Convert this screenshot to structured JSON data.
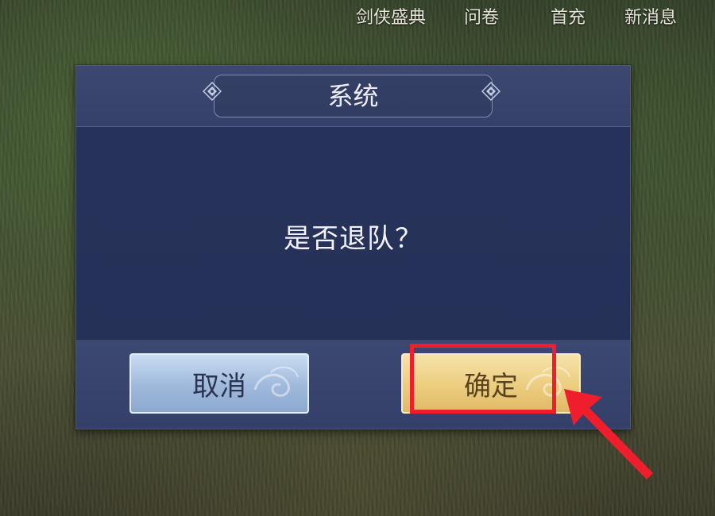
{
  "top_menu": {
    "items": [
      "剑侠盛典",
      "问卷",
      "首充",
      "新消息"
    ]
  },
  "dialog": {
    "title": "系统",
    "message": "是否退队？",
    "cancel_label": "取消",
    "confirm_label": "确定"
  },
  "annotation": {
    "highlight_color": "#f01e2c",
    "highlight_target": "confirm-button",
    "arrow_icon": "red-arrow-icon"
  },
  "colors": {
    "dialog_bg": "#273457",
    "cancel_button": "#b3c9e6",
    "confirm_button": "#ecd08a"
  }
}
